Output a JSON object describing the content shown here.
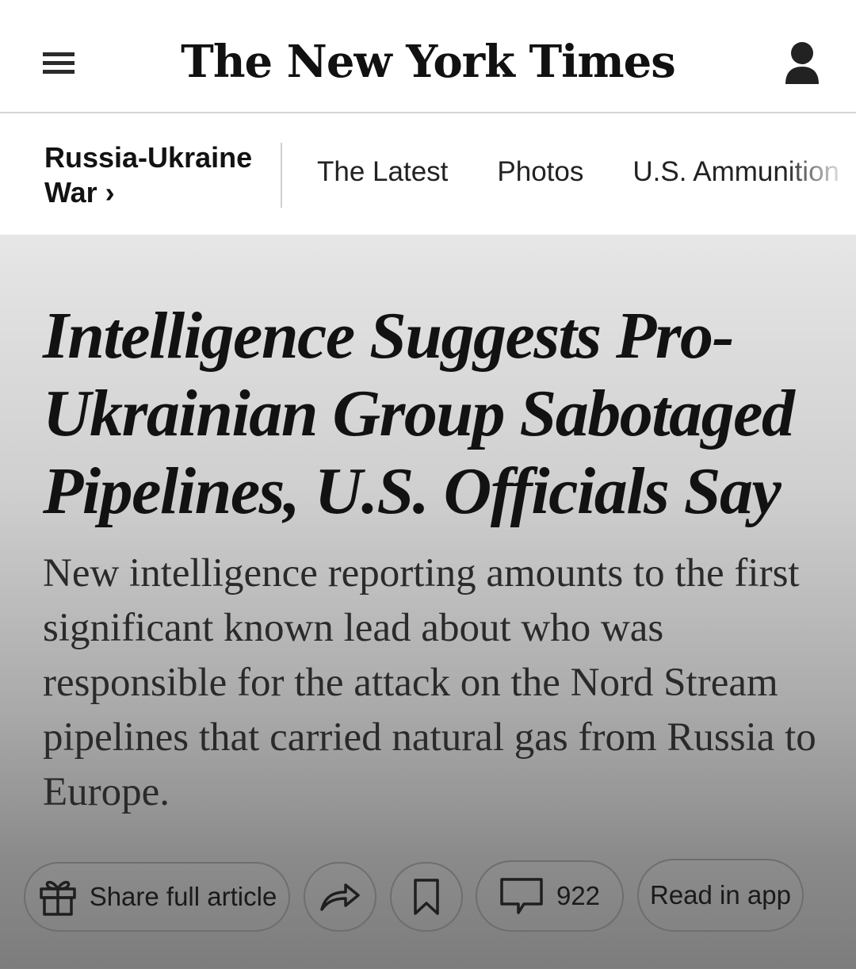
{
  "masthead": {
    "logo_text": "The New York Times",
    "menu_icon": "hamburger-menu-icon",
    "account_icon": "user-account-icon"
  },
  "section_nav": {
    "section_title": "Russia-Ukraine War ›",
    "links": [
      {
        "label": "The Latest"
      },
      {
        "label": "Photos"
      },
      {
        "label": "U.S. Ammunition Fa"
      }
    ]
  },
  "article": {
    "headline": "Intelligence Suggests Pro-Ukrainian Group Sabotaged Pipelines, U.S. Officials Say",
    "summary": "New intelligence reporting amounts to the first significant known lead about who was responsible for the attack on the Nord Stream pipelines that carried natural gas from Russia to Europe."
  },
  "actions": {
    "share_label": "Share full article",
    "share_icon": "gift-icon",
    "forward_icon": "share-arrow-icon",
    "save_icon": "bookmark-icon",
    "comment_icon": "comment-icon",
    "comment_count": "922",
    "read_in_app_label": "Read in app"
  }
}
